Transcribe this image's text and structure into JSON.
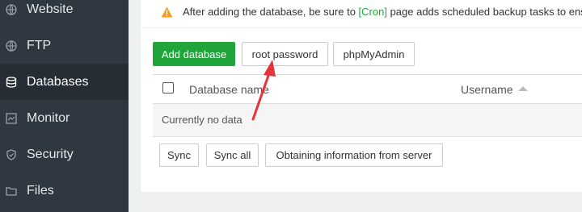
{
  "sidebar": {
    "items": [
      {
        "label": "Website",
        "icon": "globe-icon"
      },
      {
        "label": "FTP",
        "icon": "globe-icon"
      },
      {
        "label": "Databases",
        "icon": "database-icon",
        "active": true
      },
      {
        "label": "Monitor",
        "icon": "monitor-icon"
      },
      {
        "label": "Security",
        "icon": "shield-icon"
      },
      {
        "label": "Files",
        "icon": "folder-icon"
      }
    ]
  },
  "notice": {
    "text_before": "After adding the database, be sure to ",
    "link": "[Cron]",
    "text_after": " page adds scheduled backup tasks to ensure"
  },
  "toolbar": {
    "add_database": "Add database",
    "root_password": "root password",
    "phpmyadmin": "phpMyAdmin"
  },
  "table": {
    "columns": [
      "Database name",
      "Username"
    ],
    "empty_text": "Currently no data"
  },
  "footer_buttons": {
    "sync": "Sync",
    "sync_all": "Sync all",
    "obtain": "Obtaining information from server"
  },
  "colors": {
    "accent": "#20a53a",
    "sidebar_bg": "#2f3740",
    "annotation_arrow": "#e8333b"
  }
}
